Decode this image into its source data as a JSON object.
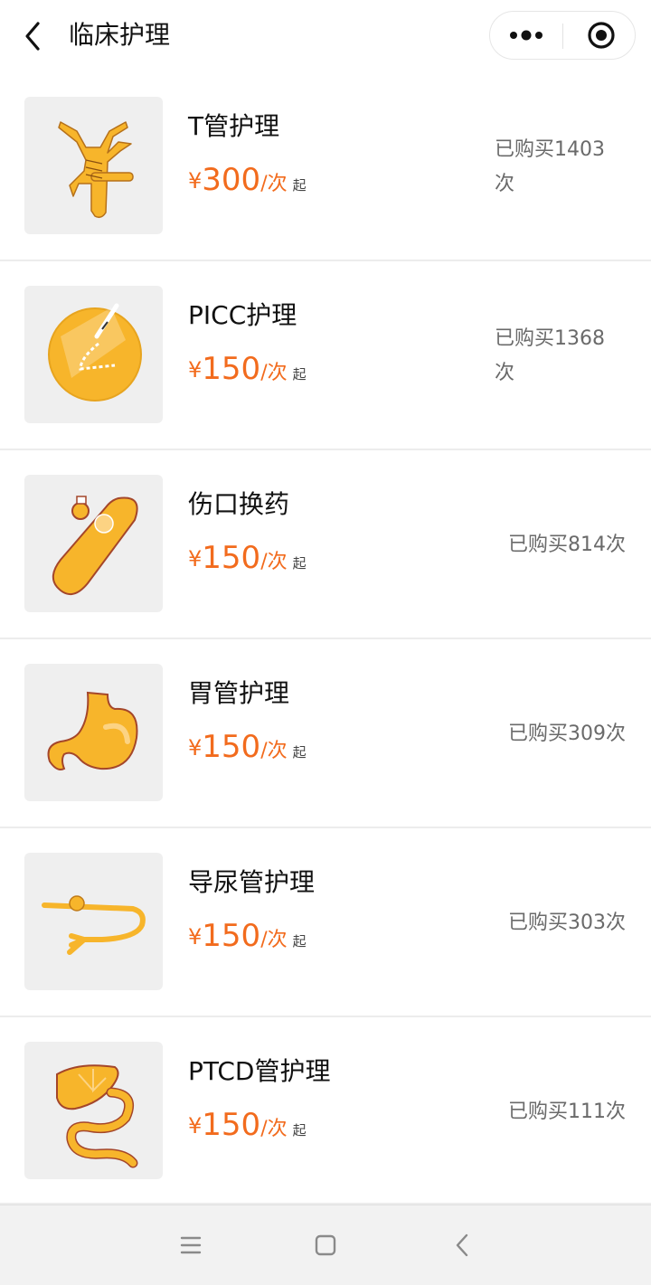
{
  "header": {
    "title": "临床护理",
    "back_icon": "chevron-left-icon",
    "more_icon": "more-dots-icon",
    "close_icon": "target-close-icon"
  },
  "colors": {
    "price": "#f26b1d",
    "thumb_bg": "#efefef",
    "illustration": "#f7b52b"
  },
  "price_prefix": "¥",
  "price_unit": "/次",
  "price_suffix": "起",
  "items": [
    {
      "name": "T管护理",
      "price": "300",
      "sold": "已购买1403次",
      "icon": "t-tube-icon"
    },
    {
      "name": "PICC护理",
      "price": "150",
      "sold": "已购买1368次",
      "icon": "picc-icon"
    },
    {
      "name": "伤口换药",
      "price": "150",
      "sold": "已购买814次",
      "icon": "wound-dressing-icon"
    },
    {
      "name": "胃管护理",
      "price": "150",
      "sold": "已购买309次",
      "icon": "stomach-icon"
    },
    {
      "name": "导尿管护理",
      "price": "150",
      "sold": "已购买303次",
      "icon": "catheter-icon"
    },
    {
      "name": "PTCD管护理",
      "price": "150",
      "sold": "已购买111次",
      "icon": "liver-intestine-icon"
    }
  ],
  "navbar": {
    "menu_icon": "menu-icon",
    "home_icon": "home-square-icon",
    "back_icon": "back-triangle-icon"
  }
}
